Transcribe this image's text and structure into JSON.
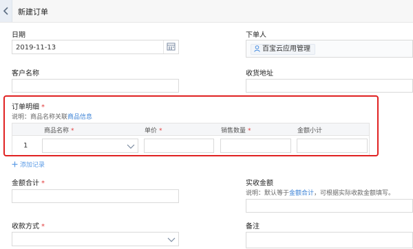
{
  "header": {
    "title": "新建订单"
  },
  "form": {
    "date": {
      "label": "日期",
      "value": "2019-11-13"
    },
    "orderer": {
      "label": "下单人",
      "user": "百宝云应用管理"
    },
    "customer": {
      "label": "客户名称"
    },
    "address": {
      "label": "收货地址"
    },
    "details": {
      "label": "订单明细",
      "required": "*",
      "note_prefix": "说明：商品名称关联",
      "note_link": "商品信息",
      "columns": [
        {
          "label": "商品名称",
          "required": "*"
        },
        {
          "label": "单价",
          "required": "*"
        },
        {
          "label": "销售数量",
          "required": "*"
        },
        {
          "label": "金额小计",
          "required": ""
        }
      ],
      "rows": [
        {
          "index": "1"
        }
      ],
      "add_row": "添加记录"
    },
    "total": {
      "label": "金额合计",
      "required": "*"
    },
    "received": {
      "label": "实收金额",
      "note_prefix": "说明：默认等于",
      "note_link": "金额合计",
      "note_suffix": "，可根据实际收款金额填写。"
    },
    "payment": {
      "label": "收款方式",
      "required": "*"
    },
    "remark": {
      "label": "备注"
    }
  },
  "colors": {
    "accent": "#3b82d6",
    "highlight_border": "#e02020",
    "required": "#e23b3b"
  },
  "icons": [
    "chevron-left-icon",
    "calendar-icon",
    "user-icon",
    "chevron-down-icon",
    "plus-icon"
  ]
}
